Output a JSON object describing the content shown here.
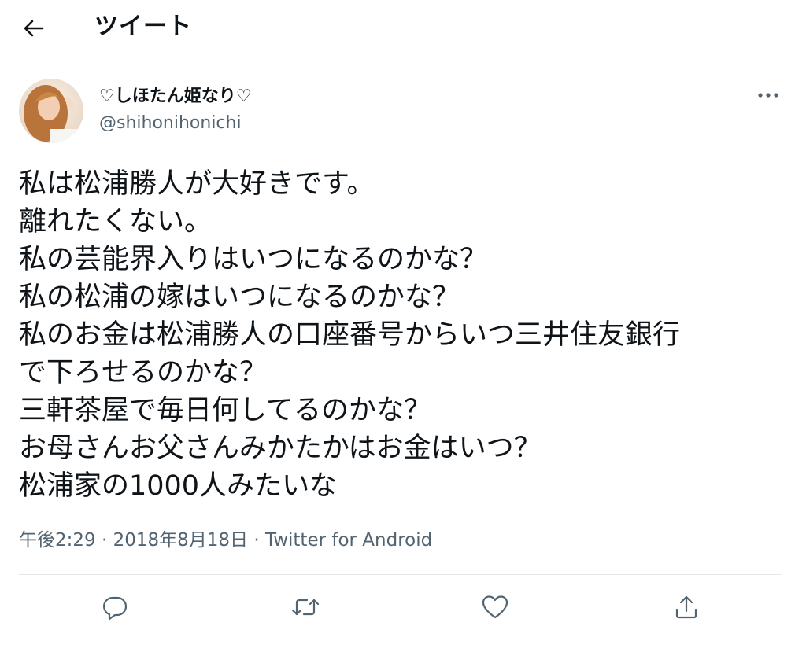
{
  "header": {
    "title": "ツイート"
  },
  "author": {
    "display_name": "♡しほたん姫なり♡",
    "handle": "@shihonihonichi"
  },
  "tweet": {
    "lines": [
      "私は松浦勝人が大好きです。",
      "離れたくない。",
      "私の芸能界入りはいつになるのかな？",
      "私の松浦の嫁はいつになるのかな？",
      "私のお金は松浦勝人の口座番号からいつ三井住友銀行",
      "で下ろせるのかな？",
      "三軒茶屋で毎日何してるのかな？",
      "お母さんお父さんみかたかはお金はいつ？",
      "松浦家の1000人みたいな"
    ]
  },
  "meta": {
    "time": "午後2:29",
    "separator": " · ",
    "date": "2018年8月18日",
    "source": "Twitter for Android"
  },
  "icons": {
    "back": "back-arrow-icon",
    "more": "more-dots-icon",
    "reply": "reply-icon",
    "retweet": "retweet-icon",
    "like": "like-heart-icon",
    "share": "share-icon"
  },
  "colors": {
    "text": "#0f1419",
    "secondary": "#536471",
    "divider": "#e6e9eb"
  }
}
